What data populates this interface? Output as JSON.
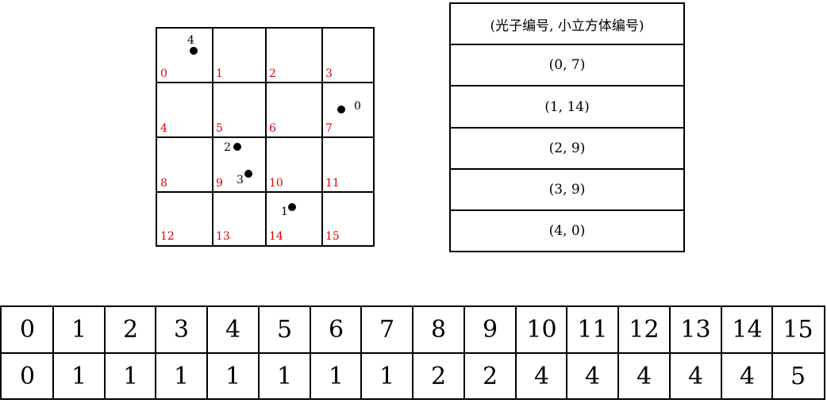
{
  "grid": {
    "rows": 4,
    "cols": 4,
    "cell_labels": [
      "0",
      "1",
      "2",
      "3",
      "4",
      "5",
      "6",
      "7",
      "8",
      "9",
      "10",
      "11",
      "12",
      "13",
      "14",
      "15"
    ],
    "photons": [
      {
        "id": "0",
        "cube": 7
      },
      {
        "id": "1",
        "cube": 14
      },
      {
        "id": "2",
        "cube": 9
      },
      {
        "id": "3",
        "cube": 9
      },
      {
        "id": "4",
        "cube": 0
      }
    ]
  },
  "pair_table": {
    "header": "(光子编号, 小立方体编号)",
    "rows": [
      "(0, 7)",
      "(1, 14)",
      "(2, 9)",
      "(3, 9)",
      "(4, 0)"
    ]
  },
  "map_table": {
    "row1": [
      "0",
      "1",
      "2",
      "3",
      "4",
      "5",
      "6",
      "7",
      "8",
      "9",
      "10",
      "11",
      "12",
      "13",
      "14",
      "15"
    ],
    "row2": [
      "0",
      "1",
      "1",
      "1",
      "1",
      "1",
      "1",
      "1",
      "2",
      "2",
      "4",
      "4",
      "4",
      "4",
      "4",
      "5"
    ]
  },
  "colors": {
    "cube_label": "#e00000",
    "line": "#000000"
  }
}
